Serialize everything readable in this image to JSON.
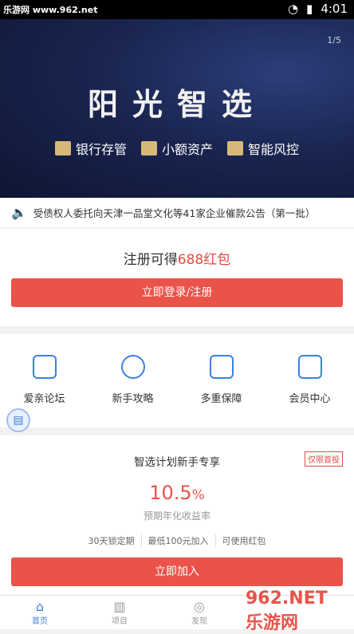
{
  "status": {
    "watermark": "乐游网 www.962.net",
    "time": "4:01"
  },
  "banner": {
    "pager": "1/5",
    "title": "阳光智选",
    "features": [
      {
        "label": "银行存管",
        "icon": "bank-icon"
      },
      {
        "label": "小额资产",
        "icon": "wallet-icon"
      },
      {
        "label": "智能风控",
        "icon": "shield-icon"
      }
    ]
  },
  "notice": {
    "text": "受债权人委托向天津一品堂文化等41家企业催款公告（第一批）"
  },
  "register": {
    "prefix": "注册可得",
    "amount": "688红包",
    "button": "立即登录/注册"
  },
  "menu": [
    {
      "label": "爱亲论坛",
      "icon": "forum-icon"
    },
    {
      "label": "新手攻略",
      "icon": "guide-icon"
    },
    {
      "label": "多重保障",
      "icon": "security-icon"
    },
    {
      "label": "会员中心",
      "icon": "crown-icon"
    }
  ],
  "plan": {
    "title": "智选计划新手专享",
    "badge": "仅限首投",
    "rate": "10.5",
    "rate_unit": "%",
    "rate_label": "预期年化收益率",
    "tags": [
      "30天锁定期",
      "最低100元加入",
      "可使用红包"
    ],
    "button": "立即加入"
  },
  "tabs": [
    {
      "label": "首页",
      "active": true
    },
    {
      "label": "项目",
      "active": false
    },
    {
      "label": "发现",
      "active": false
    }
  ],
  "brand_watermark": "962.NET 乐游网",
  "colors": {
    "accent": "#e9534a",
    "primary": "#3e7fe0"
  }
}
